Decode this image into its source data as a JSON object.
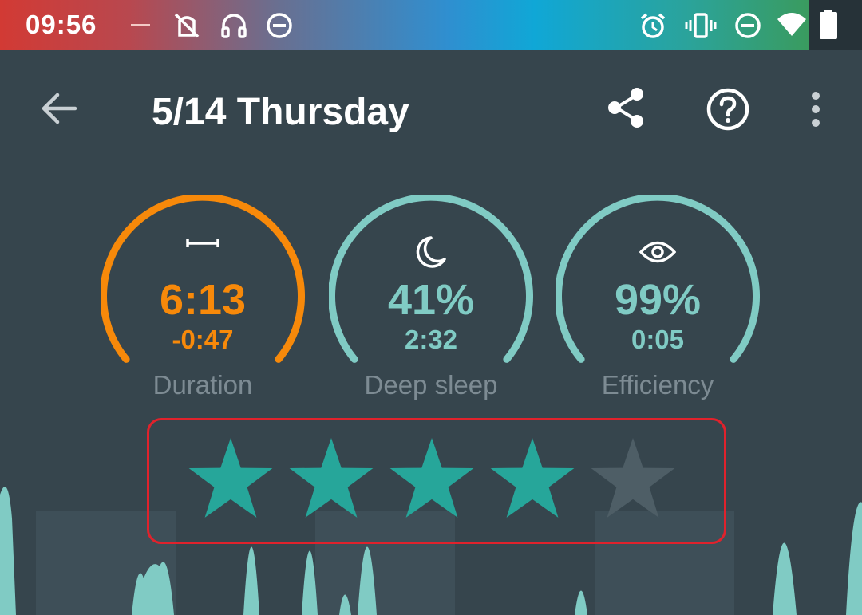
{
  "status_bar": {
    "time": "09:56",
    "icons": [
      "dash-icon",
      "no-sync-icon",
      "headphones-icon",
      "do-not-disturb-icon",
      "alarm-icon",
      "vibrate-icon",
      "do-not-disturb-icon",
      "wifi-icon",
      "battery-icon"
    ]
  },
  "app_bar": {
    "title": "5/14 Thursday",
    "back_icon": "back-arrow-icon",
    "actions": [
      "share-icon",
      "help-icon",
      "more-vert-icon"
    ]
  },
  "stats": {
    "duration": {
      "value": "6:13",
      "delta": "-0:47",
      "label": "Duration",
      "icon": "duration-icon",
      "color": "#f7890a"
    },
    "deep_sleep": {
      "value": "41%",
      "time": "2:32",
      "label": "Deep sleep",
      "icon": "moon-icon",
      "color": "#80cbc4"
    },
    "efficiency": {
      "value": "99%",
      "time": "0:05",
      "label": "Efficiency",
      "icon": "eye-icon",
      "color": "#80cbc4"
    }
  },
  "rating": {
    "stars": 4,
    "max": 5,
    "filled_color": "#26a69a",
    "empty_color": "#4e5e66"
  },
  "colors": {
    "background": "#36454d",
    "accent": "#80cbc4",
    "selection_border": "#e0222c"
  }
}
